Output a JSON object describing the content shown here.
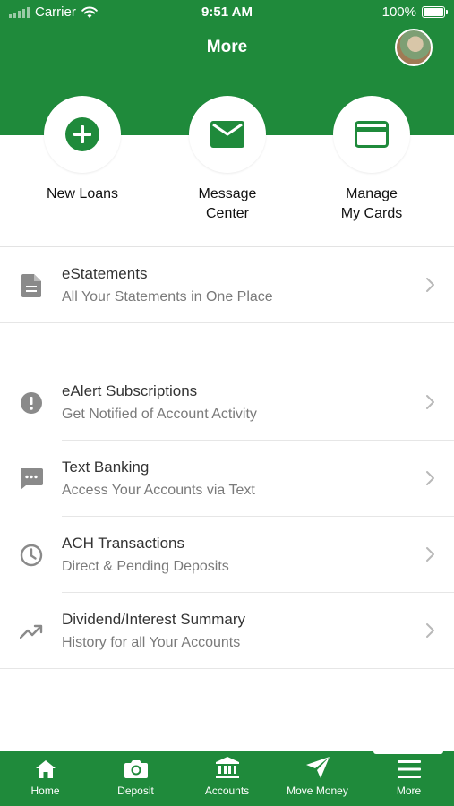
{
  "status_bar": {
    "carrier": "Carrier",
    "time": "9:51 AM",
    "battery": "100%"
  },
  "header": {
    "title": "More"
  },
  "quick_actions": [
    {
      "label": "New Loans",
      "icon": "plus-circle-icon"
    },
    {
      "label": "Message\nCenter",
      "icon": "envelope-icon"
    },
    {
      "label": "Manage\nMy Cards",
      "icon": "credit-card-icon"
    }
  ],
  "menu": [
    {
      "title": "eStatements",
      "subtitle": "All Your Statements in One Place",
      "icon": "document-icon"
    },
    {
      "title": "eAlert Subscriptions",
      "subtitle": "Get Notified of Account Activity",
      "icon": "alert-icon"
    },
    {
      "title": "Text Banking",
      "subtitle": "Access Your Accounts via Text",
      "icon": "chat-icon"
    },
    {
      "title": "ACH Transactions",
      "subtitle": "Direct & Pending Deposits",
      "icon": "clock-icon"
    },
    {
      "title": "Dividend/Interest Summary",
      "subtitle": "History for all Your Accounts",
      "icon": "trending-up-icon"
    }
  ],
  "tab_bar": {
    "tabs": [
      {
        "label": "Home",
        "icon": "home-icon"
      },
      {
        "label": "Deposit",
        "icon": "camera-icon"
      },
      {
        "label": "Accounts",
        "icon": "bank-icon"
      },
      {
        "label": "Move Money",
        "icon": "send-icon"
      },
      {
        "label": "More",
        "icon": "menu-icon"
      }
    ],
    "active": "More"
  },
  "colors": {
    "brand_green": "#1f8a3b",
    "icon_gray": "#8a8a8a",
    "background": "#ffffff"
  }
}
